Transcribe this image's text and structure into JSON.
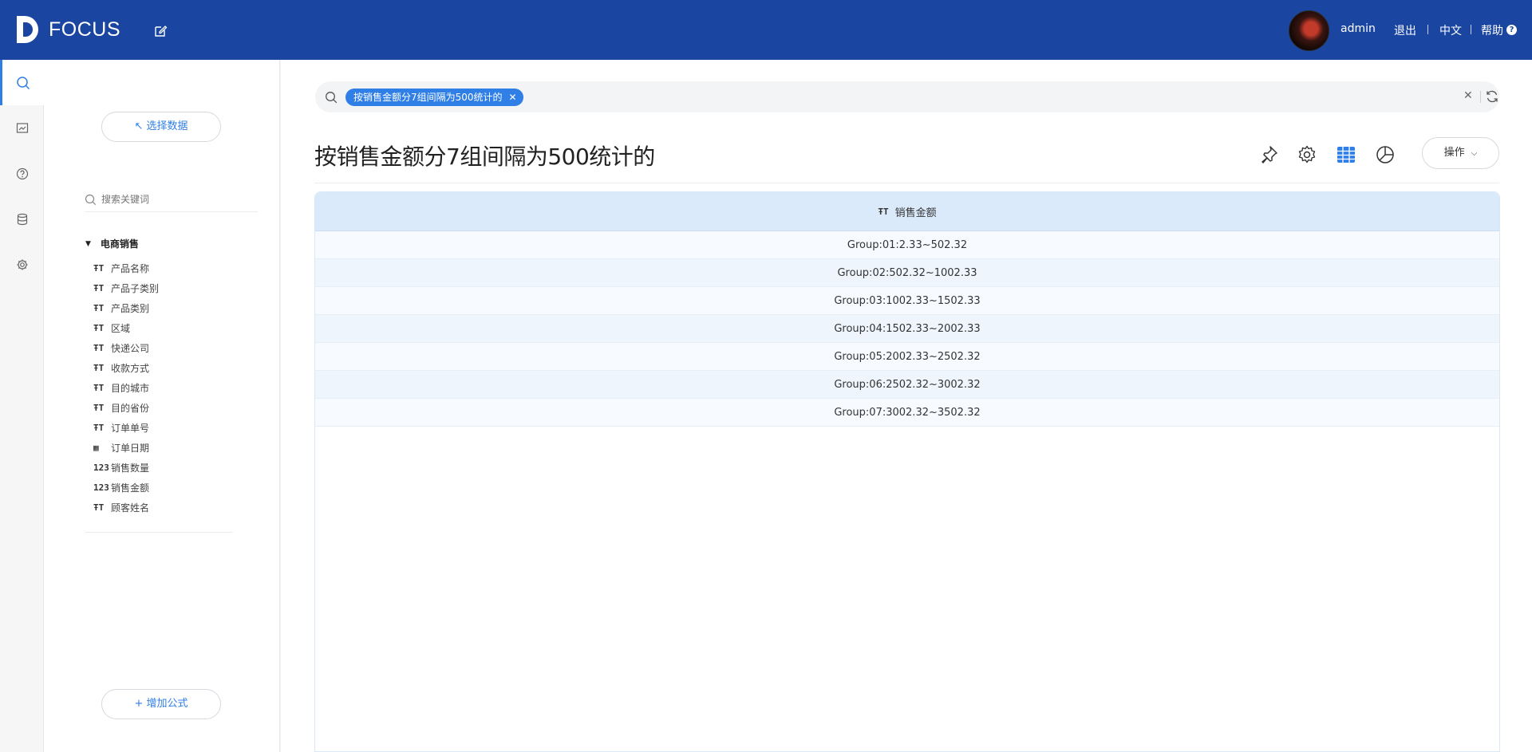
{
  "header": {
    "brand": "FOCUS",
    "user": "admin",
    "logout": "退出",
    "lang": "中文",
    "help": "帮助",
    "help_icon_glyph": "?"
  },
  "rail": {
    "items": [
      {
        "icon": "search-icon"
      },
      {
        "icon": "board-icon"
      },
      {
        "icon": "help-circle-icon"
      },
      {
        "icon": "database-icon"
      },
      {
        "icon": "gear-icon"
      }
    ]
  },
  "panel": {
    "select_data": "↖ 选择数据",
    "search_placeholder": "搜索关键词",
    "group_title": "电商销售",
    "fields": [
      {
        "type": "text",
        "label": "产品名称"
      },
      {
        "type": "text",
        "label": "产品子类别"
      },
      {
        "type": "text",
        "label": "产品类别"
      },
      {
        "type": "text",
        "label": "区域"
      },
      {
        "type": "text",
        "label": "快递公司"
      },
      {
        "type": "text",
        "label": "收款方式"
      },
      {
        "type": "text",
        "label": "目的城市"
      },
      {
        "type": "text",
        "label": "目的省份"
      },
      {
        "type": "text",
        "label": "订单单号"
      },
      {
        "type": "date",
        "label": "订单日期"
      },
      {
        "type": "number",
        "label": "销售数量"
      },
      {
        "type": "number",
        "label": "销售金额"
      },
      {
        "type": "text",
        "label": "顾客姓名"
      }
    ],
    "type_glyphs": {
      "text": "ŦT",
      "date": "▦",
      "number": "123"
    },
    "add_formula": "+ 增加公式"
  },
  "main": {
    "query_tag": "按销售金额分7组间隔为500统计的",
    "title": "按销售金额分7组间隔为500统计的",
    "operate": "操作",
    "accent": "#2f7fe6",
    "table": {
      "column": "销售金额",
      "rows": [
        "Group:01:2.33~502.32",
        "Group:02:502.32~1002.33",
        "Group:03:1002.33~1502.33",
        "Group:04:1502.33~2002.33",
        "Group:05:2002.33~2502.32",
        "Group:06:2502.32~3002.32",
        "Group:07:3002.32~3502.32"
      ]
    }
  }
}
